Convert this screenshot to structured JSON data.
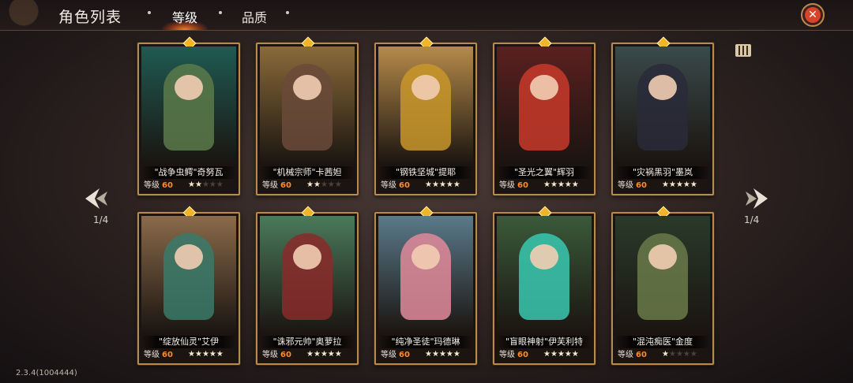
{
  "header": {
    "title": "角色列表",
    "tabs": [
      {
        "label": "等级",
        "active": true
      },
      {
        "label": "品质",
        "active": false
      }
    ],
    "close_icon": "close-icon"
  },
  "pager": {
    "left": "1/4",
    "right": "1/4"
  },
  "level_label": "等级",
  "version": "2.3.4(1004444)",
  "colors": {
    "accent": "#ff8a2a",
    "frame": "#b98a4e",
    "gem": "#f2b52a"
  },
  "cards": [
    {
      "name": "\"战争虫鳄\"奇努瓦",
      "level": "60",
      "stars": 2,
      "bg": "#1f5a52",
      "fig": "#5b7a4a"
    },
    {
      "name": "\"机械宗师\"卡茜妲",
      "level": "60",
      "stars": 2,
      "bg": "#8a6a3a",
      "fig": "#6a4a3a"
    },
    {
      "name": "\"钢铁坚城\"提耶",
      "level": "60",
      "stars": 5,
      "bg": "#b58a4a",
      "fig": "#c8962a"
    },
    {
      "name": "\"圣光之翼\"辉羽",
      "level": "60",
      "stars": 5,
      "bg": "#5a2020",
      "fig": "#c83a2a"
    },
    {
      "name": "\"灾祸黑羽\"墨岚",
      "level": "60",
      "stars": 5,
      "bg": "#3a4a4a",
      "fig": "#2a2a3a"
    },
    {
      "name": "\"绽放仙灵\"艾伊",
      "level": "60",
      "stars": 5,
      "bg": "#8a6a4a",
      "fig": "#3a7a6a"
    },
    {
      "name": "\"诛邪元帅\"奥萝拉",
      "level": "60",
      "stars": 5,
      "bg": "#4a7a5a",
      "fig": "#8a2a2a"
    },
    {
      "name": "\"纯净圣徒\"玛德琳",
      "level": "60",
      "stars": 5,
      "bg": "#5a7a8a",
      "fig": "#e08a9a"
    },
    {
      "name": "\"盲眼神射\"伊芙利特",
      "level": "60",
      "stars": 5,
      "bg": "#3a5a3a",
      "fig": "#3ac8b0"
    },
    {
      "name": "\"混沌痴医\"金度",
      "level": "60",
      "stars": 1,
      "bg": "#2a3a2a",
      "fig": "#6a7a4a"
    }
  ]
}
